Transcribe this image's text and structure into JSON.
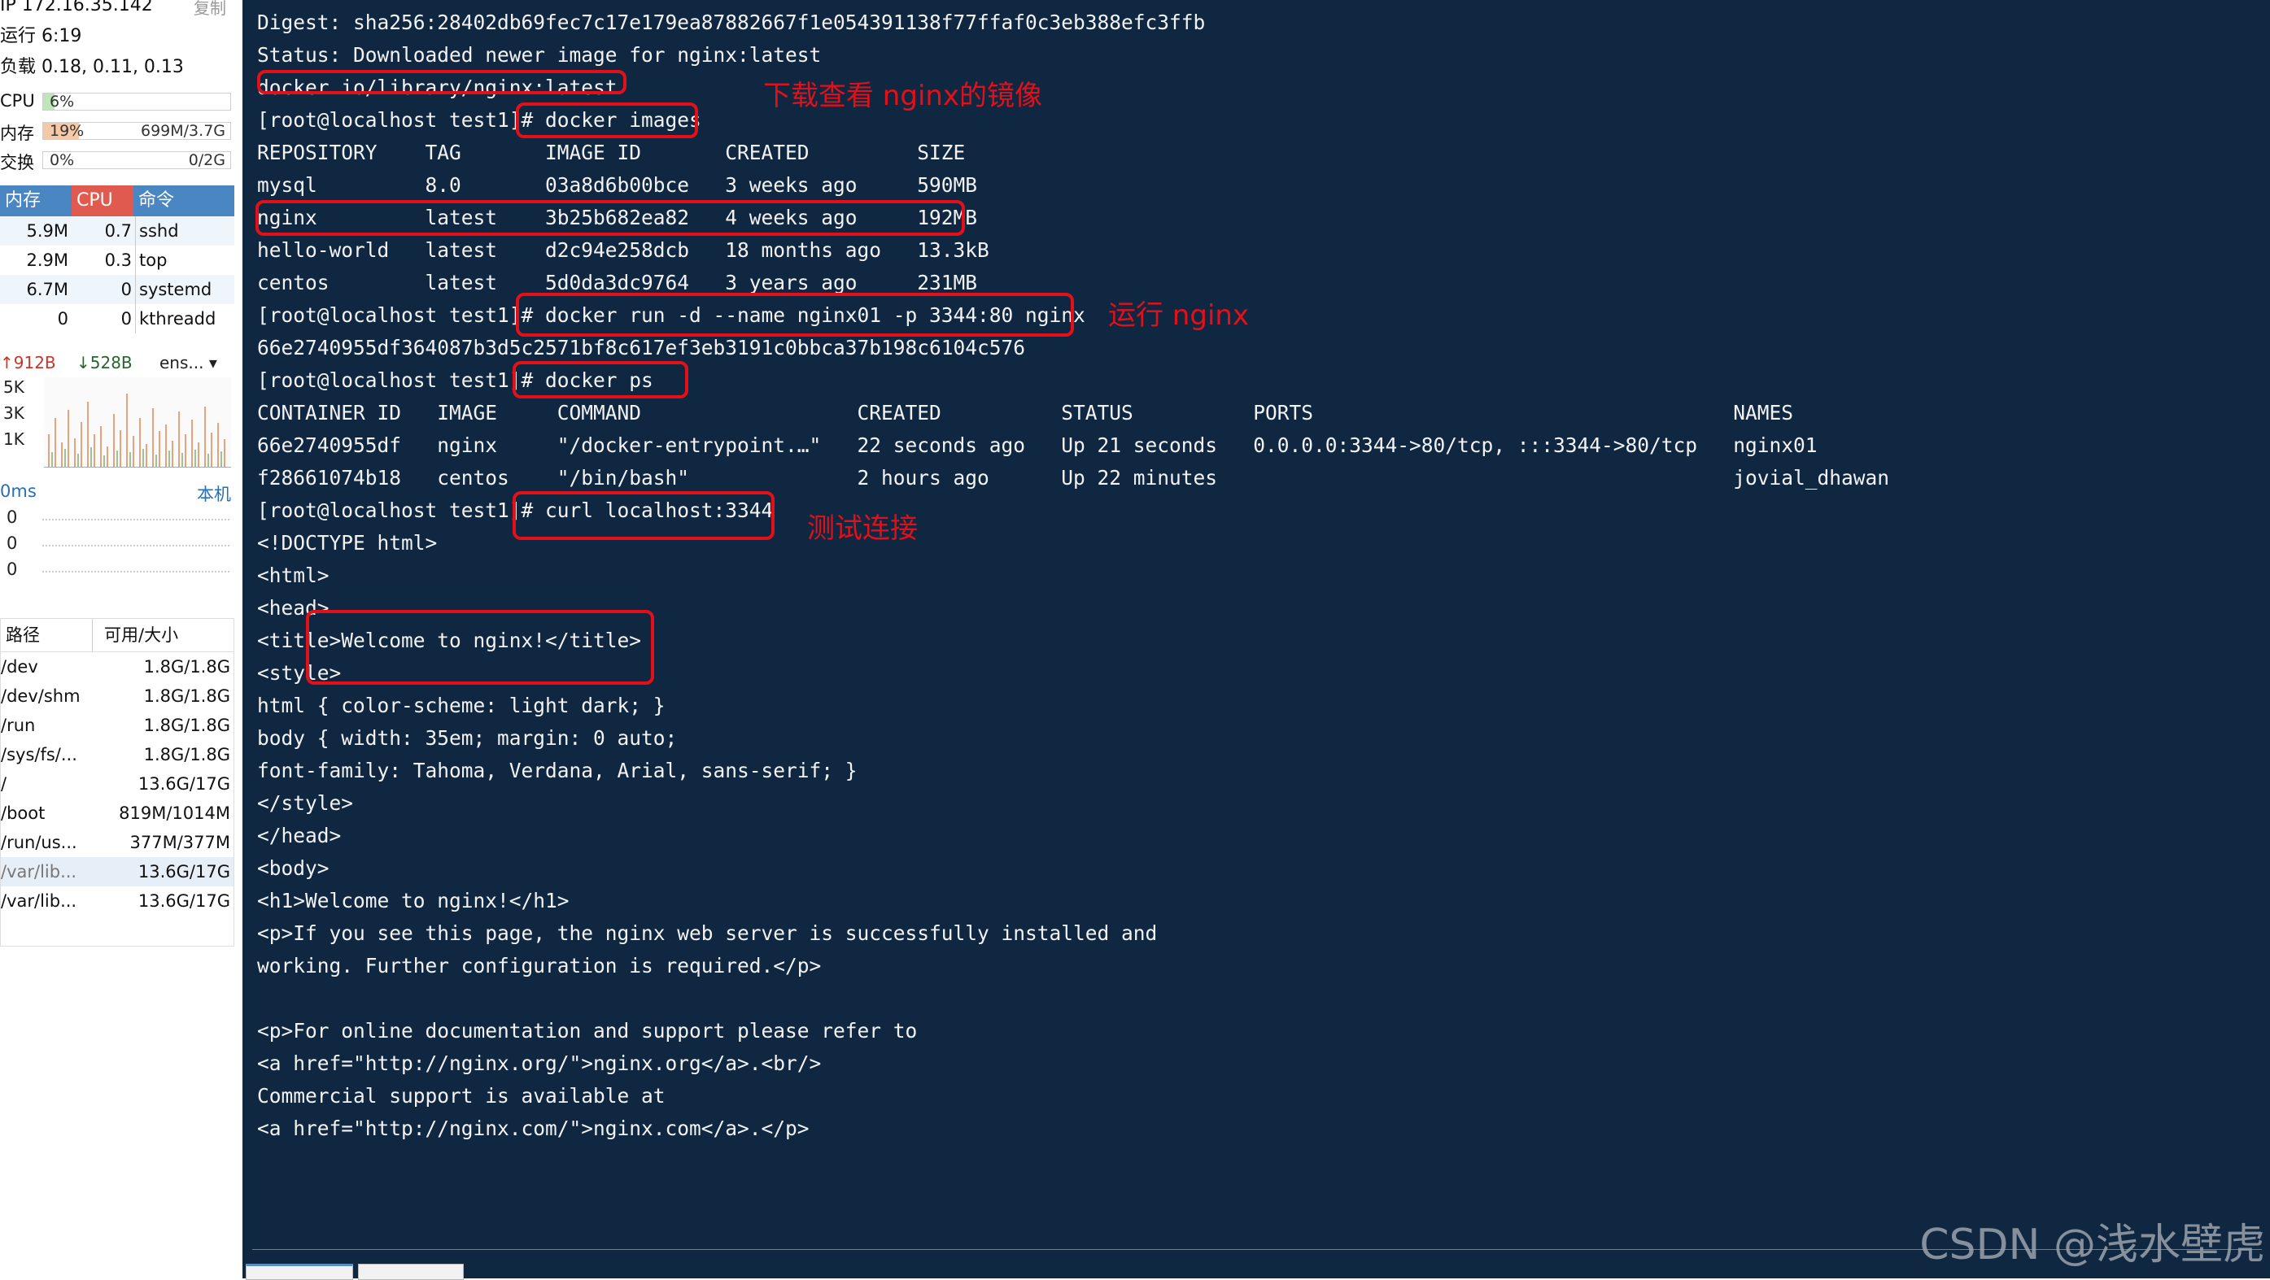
{
  "sidebar": {
    "ip": "IP 172.16.35.142",
    "copy": "复制",
    "uptime": "运行 6:19",
    "load": "负载 0.18, 0.11, 0.13",
    "resources": [
      {
        "label": "CPU",
        "percent": "6%",
        "amount": "",
        "fill": 0.06,
        "color": "#bfe6b8"
      },
      {
        "label": "内存",
        "percent": "19%",
        "amount": "699M/3.7G",
        "fill": 0.19,
        "color": "#f5c9a8"
      },
      {
        "label": "交换",
        "percent": "0%",
        "amount": "0/2G",
        "fill": 0.0,
        "color": "#dfe9f3"
      }
    ],
    "process_table": {
      "headers": {
        "mem": "内存",
        "cpu": "CPU",
        "cmd": "命令"
      },
      "rows": [
        {
          "mem": "5.9M",
          "cpu": "0.7",
          "cmd": "sshd"
        },
        {
          "mem": "2.9M",
          "cpu": "0.3",
          "cmd": "top"
        },
        {
          "mem": "6.7M",
          "cpu": "0",
          "cmd": "systemd"
        },
        {
          "mem": "0",
          "cpu": "0",
          "cmd": "kthreadd"
        }
      ]
    },
    "network": {
      "up": "↑912B",
      "down": "↓528B",
      "iface": "ens... ▾",
      "axis": [
        "5K",
        "3K",
        "1K"
      ]
    },
    "ping": {
      "title": "0ms",
      "local": "本机",
      "values": [
        "0",
        "0",
        "0"
      ]
    },
    "filesystem": {
      "headers": {
        "path": "路径",
        "size": "可用/大小"
      },
      "rows": [
        {
          "path": "/dev",
          "size": "1.8G/1.8G",
          "hl": false
        },
        {
          "path": "/dev/shm",
          "size": "1.8G/1.8G",
          "hl": false
        },
        {
          "path": "/run",
          "size": "1.8G/1.8G",
          "hl": false
        },
        {
          "path": "/sys/fs/...",
          "size": "1.8G/1.8G",
          "hl": false
        },
        {
          "path": "/",
          "size": "13.6G/17G",
          "hl": false
        },
        {
          "path": "/boot",
          "size": "819M/1014M",
          "hl": false
        },
        {
          "path": "/run/us...",
          "size": "377M/377M",
          "hl": false
        },
        {
          "path": "/var/lib...",
          "size": "13.6G/17G",
          "hl": true
        },
        {
          "path": "/var/lib...",
          "size": "13.6G/17G",
          "hl": false
        }
      ]
    }
  },
  "terminal": {
    "lines": [
      "Digest: sha256:28402db69fec7c17e179ea87882667f1e054391138f77ffaf0c3eb388efc3ffb",
      "Status: Downloaded newer image for nginx:latest",
      "docker.io/library/nginx:latest",
      "[root@localhost test1]# docker images",
      "REPOSITORY    TAG       IMAGE ID       CREATED         SIZE",
      "mysql         8.0       03a8d6b00bce   3 weeks ago     590MB",
      "nginx         latest    3b25b682ea82   4 weeks ago     192MB",
      "hello-world   latest    d2c94e258dcb   18 months ago   13.3kB",
      "centos        latest    5d0da3dc9764   3 years ago     231MB",
      "[root@localhost test1]# docker run -d --name nginx01 -p 3344:80 nginx",
      "66e2740955df364087b3d5c2571bf8c617ef3eb3191c0bbca37b198c6104c576",
      "[root@localhost test1]# docker ps",
      "CONTAINER ID   IMAGE     COMMAND                  CREATED          STATUS          PORTS                                   NAMES",
      "66e2740955df   nginx     \"/docker-entrypoint.…\"   22 seconds ago   Up 21 seconds   0.0.0.0:3344->80/tcp, :::3344->80/tcp   nginx01",
      "f28661074b18   centos    \"/bin/bash\"              2 hours ago      Up 22 minutes                                           jovial_dhawan",
      "[root@localhost test1]# curl localhost:3344",
      "<!DOCTYPE html>",
      "<html>",
      "<head>",
      "<title>Welcome to nginx!</title>",
      "<style>",
      "html { color-scheme: light dark; }",
      "body { width: 35em; margin: 0 auto;",
      "font-family: Tahoma, Verdana, Arial, sans-serif; }",
      "</style>",
      "</head>",
      "<body>",
      "<h1>Welcome to nginx!</h1>",
      "<p>If you see this page, the nginx web server is successfully installed and",
      "working. Further configuration is required.</p>",
      "",
      "<p>For online documentation and support please refer to",
      "<a href=\"http://nginx.org/\">nginx.org</a>.<br/>",
      "Commercial support is available at",
      "<a href=\"http://nginx.com/\">nginx.com</a>.</p>"
    ],
    "annotations": {
      "pull_note": "下载查看 nginx的镜像",
      "run_note": "运行 nginx",
      "test_note": "测试连接"
    },
    "watermark": "CSDN @浅水壁虎",
    "colors": {
      "background": "#0f2740",
      "annotation": "#e3101a"
    }
  }
}
